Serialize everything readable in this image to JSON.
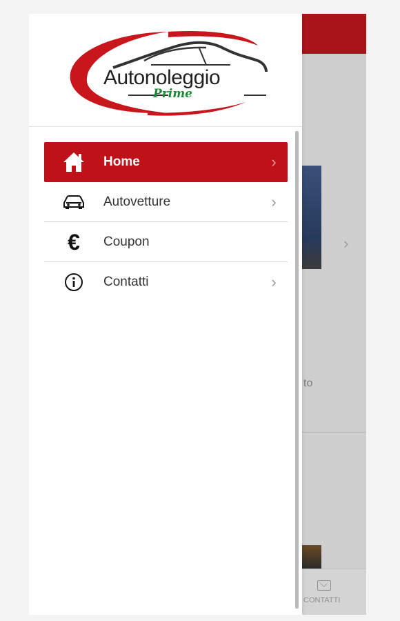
{
  "drawer": {
    "logo": {
      "text": "Autonoleggio",
      "subtext": "Prime"
    },
    "menu": [
      {
        "label": "Home",
        "icon": "home-icon",
        "active": true
      },
      {
        "label": "Autovetture",
        "icon": "car-icon"
      },
      {
        "label": "Coupon",
        "icon": "euro-icon"
      },
      {
        "label": "Contatti",
        "icon": "info-icon"
      }
    ]
  },
  "background": {
    "partial_text": "to",
    "bottom_tab_label": "CONTATTI"
  },
  "colors": {
    "accent": "#be1218"
  }
}
